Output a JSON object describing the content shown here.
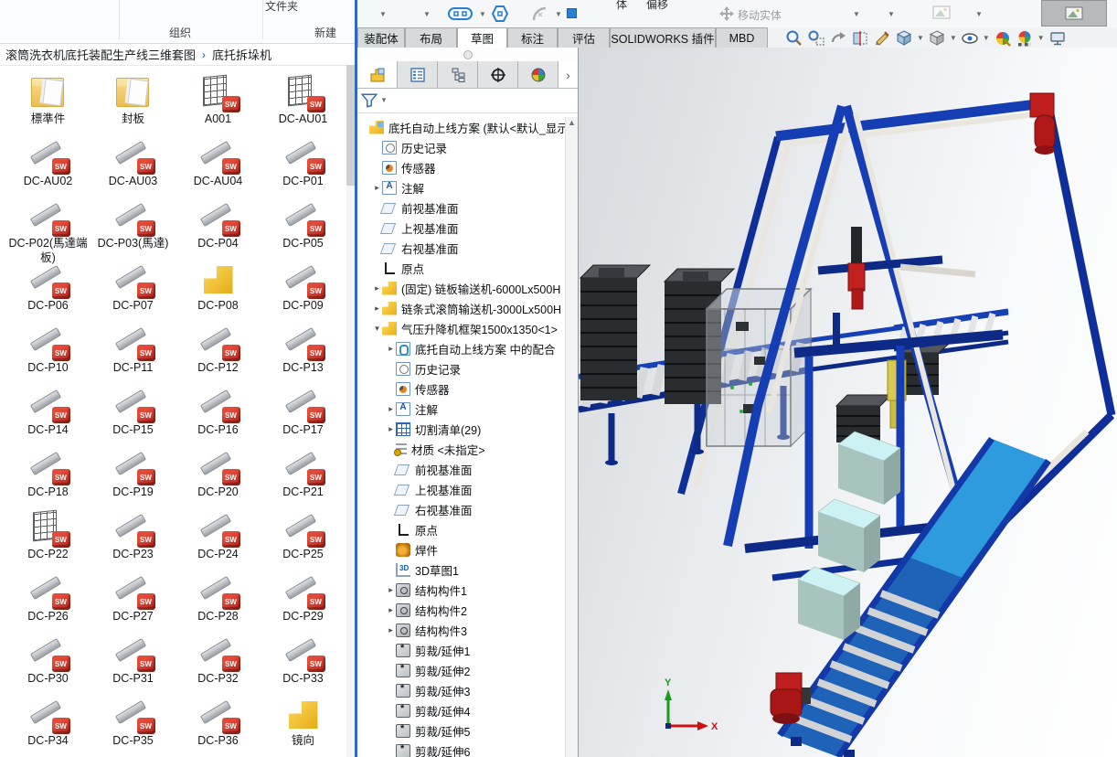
{
  "explorer": {
    "ribbon": {
      "folder_button": "文件夹",
      "organize_group": "组织",
      "new_group": "新建"
    },
    "breadcrumb": {
      "path": "滚筒洗衣机底托装配生产线三维套图",
      "current": "底托拆垛机"
    },
    "files": [
      {
        "name": "標準件",
        "type": "folder"
      },
      {
        "name": "封板",
        "type": "folder"
      },
      {
        "name": "A001",
        "type": "assembly"
      },
      {
        "name": "DC-AU01",
        "type": "assembly"
      },
      {
        "name": "DC-AU02",
        "type": "part"
      },
      {
        "name": "DC-AU03",
        "type": "part"
      },
      {
        "name": "DC-AU04",
        "type": "part"
      },
      {
        "name": "DC-P01",
        "type": "part"
      },
      {
        "name": "DC-P02(馬達端板)",
        "type": "part"
      },
      {
        "name": "DC-P03(馬達)",
        "type": "part"
      },
      {
        "name": "DC-P04",
        "type": "part"
      },
      {
        "name": "DC-P05",
        "type": "part"
      },
      {
        "name": "DC-P06",
        "type": "part"
      },
      {
        "name": "DC-P07",
        "type": "part"
      },
      {
        "name": "DC-P08",
        "type": "part-yellow"
      },
      {
        "name": "DC-P09",
        "type": "part"
      },
      {
        "name": "DC-P10",
        "type": "part"
      },
      {
        "name": "DC-P11",
        "type": "part"
      },
      {
        "name": "DC-P12",
        "type": "part"
      },
      {
        "name": "DC-P13",
        "type": "part"
      },
      {
        "name": "DC-P14",
        "type": "part"
      },
      {
        "name": "DC-P15",
        "type": "part"
      },
      {
        "name": "DC-P16",
        "type": "part"
      },
      {
        "name": "DC-P17",
        "type": "part"
      },
      {
        "name": "DC-P18",
        "type": "part"
      },
      {
        "name": "DC-P19",
        "type": "part"
      },
      {
        "name": "DC-P20",
        "type": "part"
      },
      {
        "name": "DC-P21",
        "type": "part"
      },
      {
        "name": "DC-P22",
        "type": "assembly"
      },
      {
        "name": "DC-P23",
        "type": "part"
      },
      {
        "name": "DC-P24",
        "type": "part"
      },
      {
        "name": "DC-P25",
        "type": "part"
      },
      {
        "name": "DC-P26",
        "type": "part"
      },
      {
        "name": "DC-P27",
        "type": "part"
      },
      {
        "name": "DC-P28",
        "type": "part"
      },
      {
        "name": "DC-P29",
        "type": "part"
      },
      {
        "name": "DC-P30",
        "type": "part"
      },
      {
        "name": "DC-P31",
        "type": "part"
      },
      {
        "name": "DC-P32",
        "type": "part"
      },
      {
        "name": "DC-P33",
        "type": "part"
      },
      {
        "name": "DC-P34",
        "type": "part"
      },
      {
        "name": "DC-P35",
        "type": "part"
      },
      {
        "name": "DC-P36",
        "type": "part"
      },
      {
        "name": "镜向",
        "type": "part-yellow"
      }
    ]
  },
  "sw": {
    "ribbon": {
      "body_label": "体",
      "offset_label": "偏移",
      "move_label": "移动实体"
    },
    "tabs": [
      {
        "label": "装配体"
      },
      {
        "label": "布局"
      },
      {
        "label": "草图",
        "state": "active"
      },
      {
        "label": "标注"
      },
      {
        "label": "评估"
      },
      {
        "label": "SOLIDWORKS 插件"
      },
      {
        "label": "MBD"
      }
    ],
    "panel_tabs": [
      "featuremanager",
      "propertymanager",
      "configurationmanager",
      "dimxpertmanager",
      "displaymanager"
    ],
    "headsup_buttons": [
      "zoom-to-fit",
      "zoom-to-area",
      "previous-view",
      "section-view",
      "annotation-visibility",
      "view-orientation",
      "display-style",
      "hide-show-items",
      "edit-appearance",
      "apply-scene",
      "view-settings"
    ],
    "tree": {
      "items": [
        {
          "label": "底托自动上线方案 (默认<默认_显示状",
          "icon": "asm-root",
          "level": "l0",
          "expand": "leaf"
        },
        {
          "label": "历史记录",
          "icon": "history",
          "level": "l1",
          "expand": "leaf"
        },
        {
          "label": "传感器",
          "icon": "sensor",
          "level": "l1",
          "expand": "leaf"
        },
        {
          "label": "注解",
          "icon": "annotation",
          "level": "l1",
          "expand": "collapsed"
        },
        {
          "label": "前视基准面",
          "icon": "plane",
          "level": "l1",
          "expand": "leaf"
        },
        {
          "label": "上视基准面",
          "icon": "plane",
          "level": "l1",
          "expand": "leaf"
        },
        {
          "label": "右视基准面",
          "icon": "plane",
          "level": "l1",
          "expand": "leaf"
        },
        {
          "label": "原点",
          "icon": "origin",
          "level": "l1",
          "expand": "leaf"
        },
        {
          "label": "(固定) 链板输送机-6000Lx500H",
          "icon": "assembly",
          "level": "l1",
          "expand": "collapsed"
        },
        {
          "label": "链条式滚筒输送机-3000Lx500H",
          "icon": "assembly",
          "level": "l1",
          "expand": "collapsed"
        },
        {
          "label": "气压升降机框架1500x1350<1>",
          "icon": "assembly",
          "level": "l1",
          "expand": "expanded"
        },
        {
          "label": "底托自动上线方案 中的配合",
          "icon": "mates",
          "level": "l2",
          "expand": "collapsed"
        },
        {
          "label": "历史记录",
          "icon": "history",
          "level": "l2",
          "expand": "leaf"
        },
        {
          "label": "传感器",
          "icon": "sensor",
          "level": "l2",
          "expand": "leaf"
        },
        {
          "label": "注解",
          "icon": "annotation",
          "level": "l2",
          "expand": "collapsed"
        },
        {
          "label": "切割清单(29)",
          "icon": "cutlist",
          "level": "l2",
          "expand": "collapsed"
        },
        {
          "label": "材质 <未指定>",
          "icon": "material",
          "level": "l2",
          "expand": "leaf"
        },
        {
          "label": "前视基准面",
          "icon": "plane",
          "level": "l2",
          "expand": "leaf"
        },
        {
          "label": "上视基准面",
          "icon": "plane",
          "level": "l2",
          "expand": "leaf"
        },
        {
          "label": "右视基准面",
          "icon": "plane",
          "level": "l2",
          "expand": "leaf"
        },
        {
          "label": "原点",
          "icon": "origin",
          "level": "l2",
          "expand": "leaf"
        },
        {
          "label": "焊件",
          "icon": "weldment",
          "level": "l2",
          "expand": "leaf"
        },
        {
          "label": "3D草图1",
          "icon": "sketch3d",
          "level": "l2",
          "expand": "leaf"
        },
        {
          "label": "结构构件1",
          "icon": "structural",
          "level": "l2",
          "expand": "collapsed"
        },
        {
          "label": "结构构件2",
          "icon": "structural",
          "level": "l2",
          "expand": "collapsed"
        },
        {
          "label": "结构构件3",
          "icon": "structural",
          "level": "l2",
          "expand": "collapsed"
        },
        {
          "label": "剪裁/延伸1",
          "icon": "trim",
          "level": "l2",
          "expand": "leaf"
        },
        {
          "label": "剪裁/延伸2",
          "icon": "trim",
          "level": "l2",
          "expand": "leaf"
        },
        {
          "label": "剪裁/延伸3",
          "icon": "trim",
          "level": "l2",
          "expand": "leaf"
        },
        {
          "label": "剪裁/延伸4",
          "icon": "trim",
          "level": "l2",
          "expand": "leaf"
        },
        {
          "label": "剪裁/延伸5",
          "icon": "trim",
          "level": "l2",
          "expand": "leaf"
        },
        {
          "label": "剪裁/延伸6",
          "icon": "trim",
          "level": "l2",
          "expand": "leaf"
        }
      ]
    }
  },
  "viewport": {
    "triad": {
      "x_label": "X",
      "y_label": "Y"
    },
    "model_colors": {
      "frame_blue": "#153db4",
      "rail_ivory": "#e9e6df",
      "motor_red": "#c01d1d",
      "box_cyan": "#cdf2f4",
      "deck_blue": "#2f9fe0",
      "pallet_dark": "#2a2d30"
    }
  }
}
